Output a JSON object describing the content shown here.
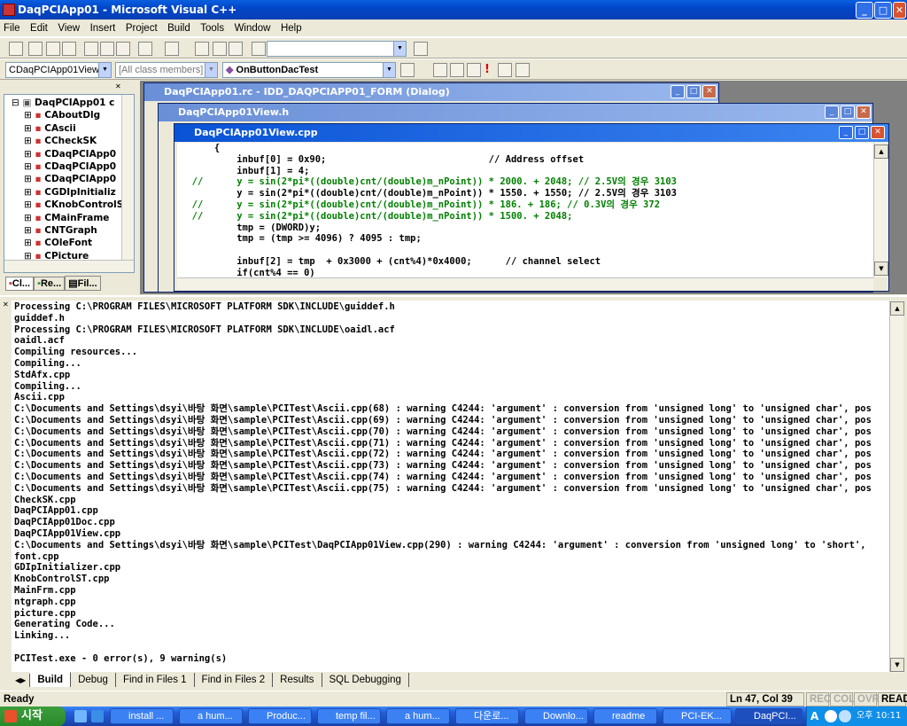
{
  "app": {
    "title": "DaqPCIApp01 - Microsoft Visual C++"
  },
  "menu": [
    "File",
    "Edit",
    "View",
    "Insert",
    "Project",
    "Build",
    "Tools",
    "Window",
    "Help"
  ],
  "toolbar": {
    "class_combo": "CDaqPCIApp01View",
    "members_combo": "[All class members]",
    "func_combo": "OnButtonDacTest"
  },
  "workspace": {
    "root": "DaqPCIApp01 c",
    "items": [
      "CAboutDlg",
      "CAscii",
      "CCheckSK",
      "CDaqPCIApp0",
      "CDaqPCIApp0",
      "CDaqPCIApp0",
      "CGDIpInitializ",
      "CKnobControlS",
      "CMainFrame",
      "CNTGraph",
      "COleFont",
      "CPicture"
    ],
    "tabs": [
      "Cl...",
      "Re...",
      "Fil..."
    ]
  },
  "windows": {
    "rc": "DaqPCIApp01.rc - IDD_DAQPCIAPP01_FORM (Dialog)",
    "header": "DaqPCIApp01View.h",
    "cpp": "DaqPCIApp01View.cpp"
  },
  "code_lines": [
    "      {",
    "          inbuf[0] = 0x90;                             // Address offset",
    "          inbuf[1] = 4;",
    "  //      y = sin(2*pi*((double)cnt/(double)m_nPoint)) * 2000. + 2048; // 2.5V의 경우 3103",
    "          y = sin(2*pi*((double)cnt/(double)m_nPoint)) * 1550. + 1550; // 2.5V의 경우 3103",
    "  //      y = sin(2*pi*((double)cnt/(double)m_nPoint)) * 186. + 186; // 0.3V의 경우 372",
    "  //      y = sin(2*pi*((double)cnt/(double)m_nPoint)) * 1500. + 2048;",
    "          tmp = (DWORD)y;",
    "          tmp = (tmp >= 4096) ? 4095 : tmp;",
    "",
    "          inbuf[2] = tmp  + 0x3000 + (cnt%4)*0x4000;      // channel select",
    "          if(cnt%4 == 0)"
  ],
  "output_lines": [
    "Processing C:\\PROGRAM FILES\\MICROSOFT PLATFORM SDK\\INCLUDE\\guiddef.h",
    "guiddef.h",
    "Processing C:\\PROGRAM FILES\\MICROSOFT PLATFORM SDK\\INCLUDE\\oaidl.acf",
    "oaidl.acf",
    "Compiling resources...",
    "Compiling...",
    "StdAfx.cpp",
    "Compiling...",
    "Ascii.cpp",
    "C:\\Documents and Settings\\dsyi\\바탕 화면\\sample\\PCITest\\Ascii.cpp(68) : warning C4244: 'argument' : conversion from 'unsigned long' to 'unsigned char', pos",
    "C:\\Documents and Settings\\dsyi\\바탕 화면\\sample\\PCITest\\Ascii.cpp(69) : warning C4244: 'argument' : conversion from 'unsigned long' to 'unsigned char', pos",
    "C:\\Documents and Settings\\dsyi\\바탕 화면\\sample\\PCITest\\Ascii.cpp(70) : warning C4244: 'argument' : conversion from 'unsigned long' to 'unsigned char', pos",
    "C:\\Documents and Settings\\dsyi\\바탕 화면\\sample\\PCITest\\Ascii.cpp(71) : warning C4244: 'argument' : conversion from 'unsigned long' to 'unsigned char', pos",
    "C:\\Documents and Settings\\dsyi\\바탕 화면\\sample\\PCITest\\Ascii.cpp(72) : warning C4244: 'argument' : conversion from 'unsigned long' to 'unsigned char', pos",
    "C:\\Documents and Settings\\dsyi\\바탕 화면\\sample\\PCITest\\Ascii.cpp(73) : warning C4244: 'argument' : conversion from 'unsigned long' to 'unsigned char', pos",
    "C:\\Documents and Settings\\dsyi\\바탕 화면\\sample\\PCITest\\Ascii.cpp(74) : warning C4244: 'argument' : conversion from 'unsigned long' to 'unsigned char', pos",
    "C:\\Documents and Settings\\dsyi\\바탕 화면\\sample\\PCITest\\Ascii.cpp(75) : warning C4244: 'argument' : conversion from 'unsigned long' to 'unsigned char', pos",
    "CheckSK.cpp",
    "DaqPCIApp01.cpp",
    "DaqPCIApp01Doc.cpp",
    "DaqPCIApp01View.cpp",
    "C:\\Documents and Settings\\dsyi\\바탕 화면\\sample\\PCITest\\DaqPCIApp01View.cpp(290) : warning C4244: 'argument' : conversion from 'unsigned long' to 'short',",
    "font.cpp",
    "GDIpInitializer.cpp",
    "KnobControlST.cpp",
    "MainFrm.cpp",
    "ntgraph.cpp",
    "picture.cpp",
    "Generating Code...",
    "Linking...",
    "",
    "PCITest.exe - 0 error(s), 9 warning(s)"
  ],
  "output_tabs": [
    "Build",
    "Debug",
    "Find in Files 1",
    "Find in Files 2",
    "Results",
    "SQL Debugging"
  ],
  "status": {
    "text": "Ready",
    "position": "Ln 47, Col 39",
    "rec": "REC",
    "col": "COL",
    "ovr": "OVR",
    "read": "READ"
  },
  "taskbar": {
    "start": "시작",
    "tasks": [
      "install ...",
      "a hum...",
      "Produc...",
      "temp fil...",
      "a hum...",
      "다운로...",
      "Downlo...",
      "readme",
      "PCI-EK...",
      "DaqPCI..."
    ],
    "ime": "A",
    "clock": "오후 10:11"
  }
}
